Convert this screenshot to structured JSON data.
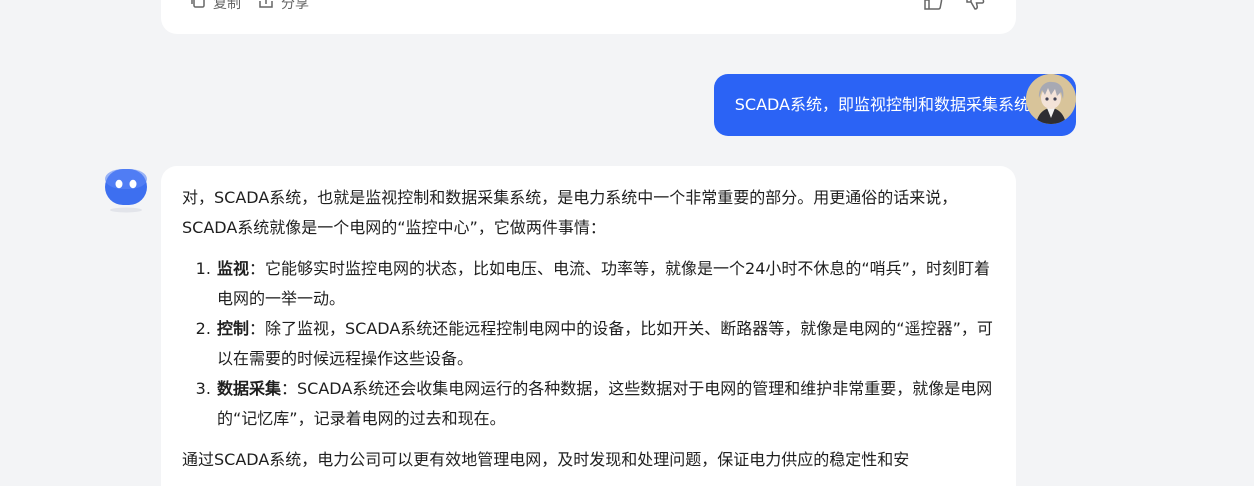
{
  "previous_message": {
    "copy_label": "复制",
    "share_label": "分享"
  },
  "user_message": {
    "text": "SCADA系统，即监视控制和数据采集系统。（"
  },
  "assistant_message": {
    "intro": "对，SCADA系统，也就是监视控制和数据采集系统，是电力系统中一个非常重要的部分。用更通俗的话来说，SCADA系统就像是一个电网的“监控中心”，它做两件事情：",
    "items": [
      {
        "title": "监视",
        "text": "：它能够实时监控电网的状态，比如电压、电流、功率等，就像是一个24小时不休息的“哨兵”，时刻盯着电网的一举一动。"
      },
      {
        "title": "控制",
        "text": "：除了监视，SCADA系统还能远程控制电网中的设备，比如开关、断路器等，就像是电网的“遥控器”，可以在需要的时候远程操作这些设备。"
      },
      {
        "title": "数据采集",
        "text": "：SCADA系统还会收集电网运行的各种数据，这些数据对于电网的管理和维护非常重要，就像是电网的“记忆库”，记录着电网的过去和现在。"
      }
    ],
    "closing": "通过SCADA系统，电力公司可以更有效地管理电网，及时发现和处理问题，保证电力供应的稳定性和安"
  },
  "colors": {
    "user_bubble": "#2b63f5",
    "page_background": "#f3f4f6",
    "card_background": "#ffffff"
  },
  "icons": [
    "copy-icon",
    "share-icon",
    "thumbs-up-icon",
    "thumbs-down-icon",
    "bot-avatar-icon",
    "user-avatar"
  ]
}
